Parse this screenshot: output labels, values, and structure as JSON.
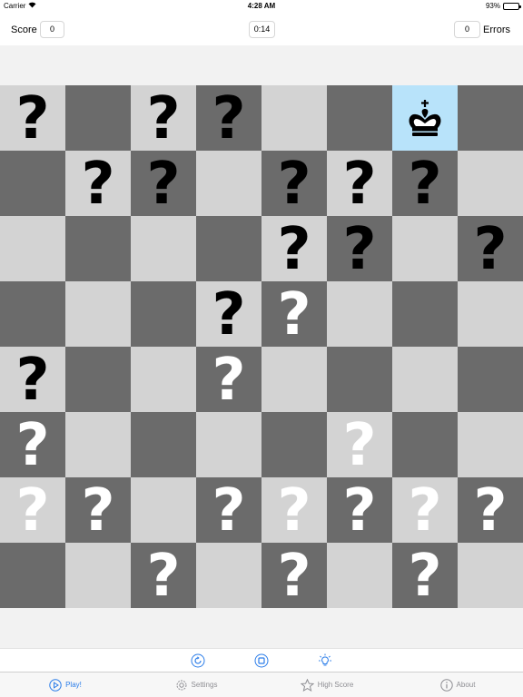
{
  "status_bar": {
    "carrier": "Carrier",
    "time": "4:28 AM",
    "battery": "93%",
    "battery_level": 0.93
  },
  "top_bar": {
    "score_label": "Score",
    "score_value": "0",
    "timer": "0:14",
    "errors_value": "0",
    "errors_label": "Errors"
  },
  "board": {
    "rows": [
      [
        "qb",
        "",
        "qb",
        "qb",
        "",
        "",
        "K",
        ""
      ],
      [
        "",
        "qb",
        "qb",
        "",
        "qb",
        "qb",
        "qb",
        ""
      ],
      [
        "",
        "",
        "",
        "",
        "qb",
        "qb",
        "",
        "qb"
      ],
      [
        "",
        "",
        "",
        "qb",
        "qw",
        "",
        "",
        ""
      ],
      [
        "qb",
        "",
        "",
        "qw",
        "",
        "",
        "",
        ""
      ],
      [
        "qw",
        "",
        "",
        "",
        "",
        "qw",
        "",
        ""
      ],
      [
        "qw",
        "qw",
        "",
        "qw",
        "qw",
        "qw",
        "qw",
        "qw"
      ],
      [
        "",
        "",
        "qw",
        "",
        "qw",
        "",
        "qw",
        ""
      ]
    ],
    "question_glyph": "?",
    "highlight_color": "#b8e3fa",
    "light_color": "#d3d3d3",
    "dark_color": "#6b6b6b"
  },
  "action_bar": {
    "buttons": [
      "restart-icon",
      "stop-icon",
      "hint-bulb-icon"
    ],
    "accent_color": "#2b7de9"
  },
  "tab_bar": {
    "tabs": [
      {
        "label": "Play!",
        "icon": "play-icon",
        "active": true
      },
      {
        "label": "Settings",
        "icon": "gear-icon",
        "active": false
      },
      {
        "label": "High Score",
        "icon": "star-icon",
        "active": false
      },
      {
        "label": "About",
        "icon": "info-icon",
        "active": false
      }
    ]
  }
}
